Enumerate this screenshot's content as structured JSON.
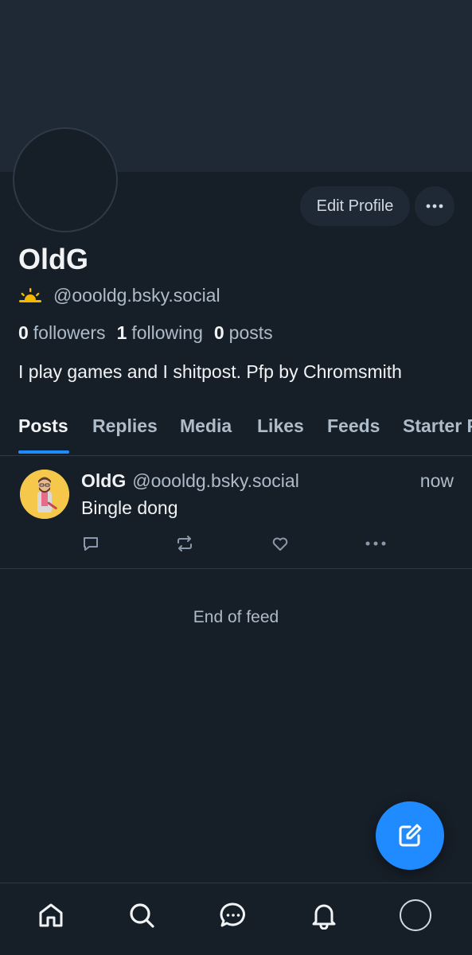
{
  "profile": {
    "display_name": "OldG",
    "handle": "@oooldg.bsky.social",
    "followers_count": "0",
    "followers_label": "followers",
    "following_count": "1",
    "following_label": "following",
    "posts_count": "0",
    "posts_label": "posts",
    "bio": "I play games and I shitpost. Pfp by Chromsmith",
    "edit_button_label": "Edit Profile"
  },
  "tabs": [
    {
      "label": "Posts",
      "active": true
    },
    {
      "label": "Replies"
    },
    {
      "label": "Media"
    },
    {
      "label": "Likes"
    },
    {
      "label": "Feeds"
    },
    {
      "label": "Starter Packs"
    }
  ],
  "post": {
    "author": "OldG",
    "handle": "@oooldg.bsky.social",
    "time": "now",
    "text": "Bingle dong"
  },
  "feed_end_text": "End of feed",
  "colors": {
    "background": "#161e27",
    "banner": "#1e2935",
    "accent": "#208bfe",
    "muted_text": "#aebbc9",
    "sun_icon": "#f5b800"
  },
  "icons": {
    "handle_prefix": "sun-icon",
    "nav": [
      "home-icon",
      "search-icon",
      "chat-icon",
      "bell-icon",
      "profile-avatar"
    ],
    "post_actions": [
      "reply-icon",
      "repost-icon",
      "like-icon",
      "more-icon"
    ],
    "fab": "compose-icon"
  }
}
